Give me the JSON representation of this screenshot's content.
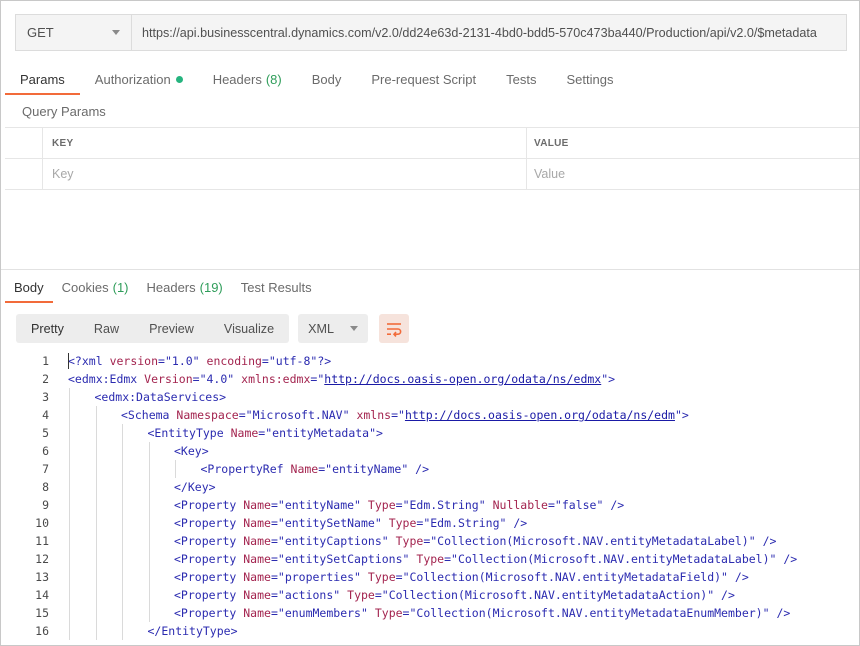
{
  "request": {
    "method": "GET",
    "url": "https://api.businesscentral.dynamics.com/v2.0/dd24e63d-2131-4bd0-bdd5-570c473ba440/Production/api/v2.0/$metadata"
  },
  "request_tabs": [
    {
      "label": "Params",
      "count": ""
    },
    {
      "label": "Authorization",
      "count": ""
    },
    {
      "label": "Headers",
      "count": "(8)"
    },
    {
      "label": "Body",
      "count": ""
    },
    {
      "label": "Pre-request Script",
      "count": ""
    },
    {
      "label": "Tests",
      "count": ""
    },
    {
      "label": "Settings",
      "count": ""
    }
  ],
  "query_params": {
    "title": "Query Params",
    "key_header": "KEY",
    "value_header": "VALUE",
    "key_placeholder": "Key",
    "value_placeholder": "Value"
  },
  "response_tabs": [
    {
      "label": "Body",
      "count": ""
    },
    {
      "label": "Cookies",
      "count": "(1)"
    },
    {
      "label": "Headers",
      "count": "(19)"
    },
    {
      "label": "Test Results",
      "count": ""
    }
  ],
  "response_toolbar": {
    "views": [
      "Pretty",
      "Raw",
      "Preview",
      "Visualize"
    ],
    "format": "XML"
  },
  "code_lines": [
    {
      "n": "1",
      "indent": 0,
      "parts": [
        [
          "p",
          "<?"
        ],
        [
          "t",
          "xml "
        ],
        [
          "a",
          "version"
        ],
        [
          "p",
          "="
        ],
        [
          "v",
          "\"1.0\""
        ],
        [
          "p",
          " "
        ],
        [
          "a",
          "encoding"
        ],
        [
          "p",
          "="
        ],
        [
          "v",
          "\"utf-8\""
        ],
        [
          "p",
          "?>"
        ]
      ]
    },
    {
      "n": "2",
      "indent": 0,
      "parts": [
        [
          "t",
          "<edmx:Edmx "
        ],
        [
          "a",
          "Version"
        ],
        [
          "p",
          "="
        ],
        [
          "v",
          "\"4.0\""
        ],
        [
          "p",
          " "
        ],
        [
          "a",
          "xmlns:edmx"
        ],
        [
          "p",
          "="
        ],
        [
          "v",
          "\""
        ],
        [
          "u",
          "http://docs.oasis-open.org/odata/ns/edmx"
        ],
        [
          "v",
          "\""
        ],
        [
          "t",
          ">"
        ]
      ]
    },
    {
      "n": "3",
      "indent": 1,
      "parts": [
        [
          "t",
          "<edmx:DataServices>"
        ]
      ]
    },
    {
      "n": "4",
      "indent": 2,
      "parts": [
        [
          "t",
          "<Schema "
        ],
        [
          "a",
          "Namespace"
        ],
        [
          "p",
          "="
        ],
        [
          "v",
          "\"Microsoft.NAV\""
        ],
        [
          "p",
          " "
        ],
        [
          "a",
          "xmlns"
        ],
        [
          "p",
          "="
        ],
        [
          "v",
          "\""
        ],
        [
          "u",
          "http://docs.oasis-open.org/odata/ns/edm"
        ],
        [
          "v",
          "\""
        ],
        [
          "t",
          ">"
        ]
      ]
    },
    {
      "n": "5",
      "indent": 3,
      "parts": [
        [
          "t",
          "<EntityType "
        ],
        [
          "a",
          "Name"
        ],
        [
          "p",
          "="
        ],
        [
          "v",
          "\"entityMetadata\""
        ],
        [
          "t",
          ">"
        ]
      ]
    },
    {
      "n": "6",
      "indent": 4,
      "parts": [
        [
          "t",
          "<Key>"
        ]
      ]
    },
    {
      "n": "7",
      "indent": 5,
      "parts": [
        [
          "t",
          "<PropertyRef "
        ],
        [
          "a",
          "Name"
        ],
        [
          "p",
          "="
        ],
        [
          "v",
          "\"entityName\""
        ],
        [
          "t",
          " />"
        ]
      ]
    },
    {
      "n": "8",
      "indent": 4,
      "parts": [
        [
          "t",
          "</Key>"
        ]
      ]
    },
    {
      "n": "9",
      "indent": 4,
      "parts": [
        [
          "t",
          "<Property "
        ],
        [
          "a",
          "Name"
        ],
        [
          "p",
          "="
        ],
        [
          "v",
          "\"entityName\""
        ],
        [
          "p",
          " "
        ],
        [
          "a",
          "Type"
        ],
        [
          "p",
          "="
        ],
        [
          "v",
          "\"Edm.String\""
        ],
        [
          "p",
          " "
        ],
        [
          "a",
          "Nullable"
        ],
        [
          "p",
          "="
        ],
        [
          "v",
          "\"false\""
        ],
        [
          "t",
          " />"
        ]
      ]
    },
    {
      "n": "10",
      "indent": 4,
      "parts": [
        [
          "t",
          "<Property "
        ],
        [
          "a",
          "Name"
        ],
        [
          "p",
          "="
        ],
        [
          "v",
          "\"entitySetName\""
        ],
        [
          "p",
          " "
        ],
        [
          "a",
          "Type"
        ],
        [
          "p",
          "="
        ],
        [
          "v",
          "\"Edm.String\""
        ],
        [
          "t",
          " />"
        ]
      ]
    },
    {
      "n": "11",
      "indent": 4,
      "parts": [
        [
          "t",
          "<Property "
        ],
        [
          "a",
          "Name"
        ],
        [
          "p",
          "="
        ],
        [
          "v",
          "\"entityCaptions\""
        ],
        [
          "p",
          " "
        ],
        [
          "a",
          "Type"
        ],
        [
          "p",
          "="
        ],
        [
          "v",
          "\"Collection(Microsoft.NAV.entityMetadataLabel)\""
        ],
        [
          "t",
          " />"
        ]
      ]
    },
    {
      "n": "12",
      "indent": 4,
      "parts": [
        [
          "t",
          "<Property "
        ],
        [
          "a",
          "Name"
        ],
        [
          "p",
          "="
        ],
        [
          "v",
          "\"entitySetCaptions\""
        ],
        [
          "p",
          " "
        ],
        [
          "a",
          "Type"
        ],
        [
          "p",
          "="
        ],
        [
          "v",
          "\"Collection(Microsoft.NAV.entityMetadataLabel)\""
        ],
        [
          "t",
          " />"
        ]
      ]
    },
    {
      "n": "13",
      "indent": 4,
      "parts": [
        [
          "t",
          "<Property "
        ],
        [
          "a",
          "Name"
        ],
        [
          "p",
          "="
        ],
        [
          "v",
          "\"properties\""
        ],
        [
          "p",
          " "
        ],
        [
          "a",
          "Type"
        ],
        [
          "p",
          "="
        ],
        [
          "v",
          "\"Collection(Microsoft.NAV.entityMetadataField)\""
        ],
        [
          "t",
          " />"
        ]
      ]
    },
    {
      "n": "14",
      "indent": 4,
      "parts": [
        [
          "t",
          "<Property "
        ],
        [
          "a",
          "Name"
        ],
        [
          "p",
          "="
        ],
        [
          "v",
          "\"actions\""
        ],
        [
          "p",
          " "
        ],
        [
          "a",
          "Type"
        ],
        [
          "p",
          "="
        ],
        [
          "v",
          "\"Collection(Microsoft.NAV.entityMetadataAction)\""
        ],
        [
          "t",
          " />"
        ]
      ]
    },
    {
      "n": "15",
      "indent": 4,
      "parts": [
        [
          "t",
          "<Property "
        ],
        [
          "a",
          "Name"
        ],
        [
          "p",
          "="
        ],
        [
          "v",
          "\"enumMembers\""
        ],
        [
          "p",
          " "
        ],
        [
          "a",
          "Type"
        ],
        [
          "p",
          "="
        ],
        [
          "v",
          "\"Collection(Microsoft.NAV.entityMetadataEnumMember)\""
        ],
        [
          "t",
          " />"
        ]
      ]
    },
    {
      "n": "16",
      "indent": 3,
      "parts": [
        [
          "t",
          "</EntityType>"
        ]
      ]
    }
  ]
}
